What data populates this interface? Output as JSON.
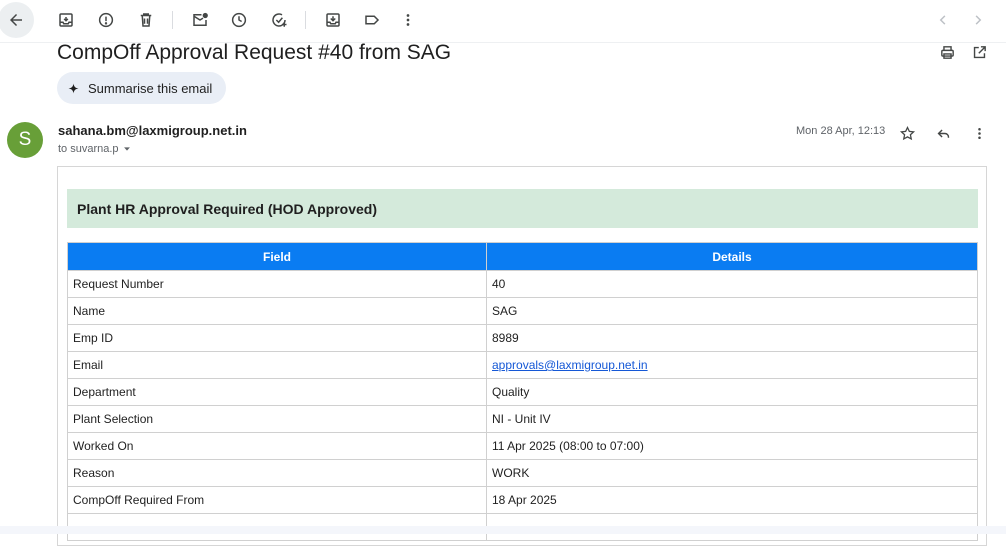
{
  "toolbar": {
    "back_icon": "back-arrow-icon",
    "actions": [
      "archive-icon",
      "report-spam-icon",
      "delete-icon",
      "mark-unread-icon",
      "snooze-icon",
      "add-to-tasks-icon",
      "move-to-icon",
      "labels-icon",
      "more-options-icon"
    ],
    "nav": [
      "previous-message-icon",
      "next-message-icon"
    ]
  },
  "subject": "CompOff Approval Request #40 from SAG",
  "summarise_label": "Summarise this email",
  "sender": {
    "avatar_letter": "S",
    "avatar_color": "#689f38",
    "email": "sahana.bm@laxmigroup.net.in",
    "recipient": "to suvarna.p",
    "timestamp": "Mon 28 Apr, 12:13"
  },
  "body": {
    "banner": "Plant HR Approval Required (HOD Approved)",
    "banner_color": "#d4eadb",
    "table_header": [
      "Field",
      "Details"
    ],
    "header_color": "#0a7cf2",
    "rows": [
      {
        "field": "Request Number",
        "value": "40"
      },
      {
        "field": "Name",
        "value": "SAG"
      },
      {
        "field": "Emp ID",
        "value": "8989"
      },
      {
        "field": "Email",
        "value": "approvals@laxmigroup.net.in"
      },
      {
        "field": "Department",
        "value": "Quality"
      },
      {
        "field": "Plant Selection",
        "value": "NI - Unit IV"
      },
      {
        "field": "Worked On",
        "value": "11 Apr 2025 (08:00 to 07:00)"
      },
      {
        "field": "Reason",
        "value": "WORK"
      },
      {
        "field": "CompOff Required From",
        "value": "18 Apr 2025"
      }
    ]
  }
}
